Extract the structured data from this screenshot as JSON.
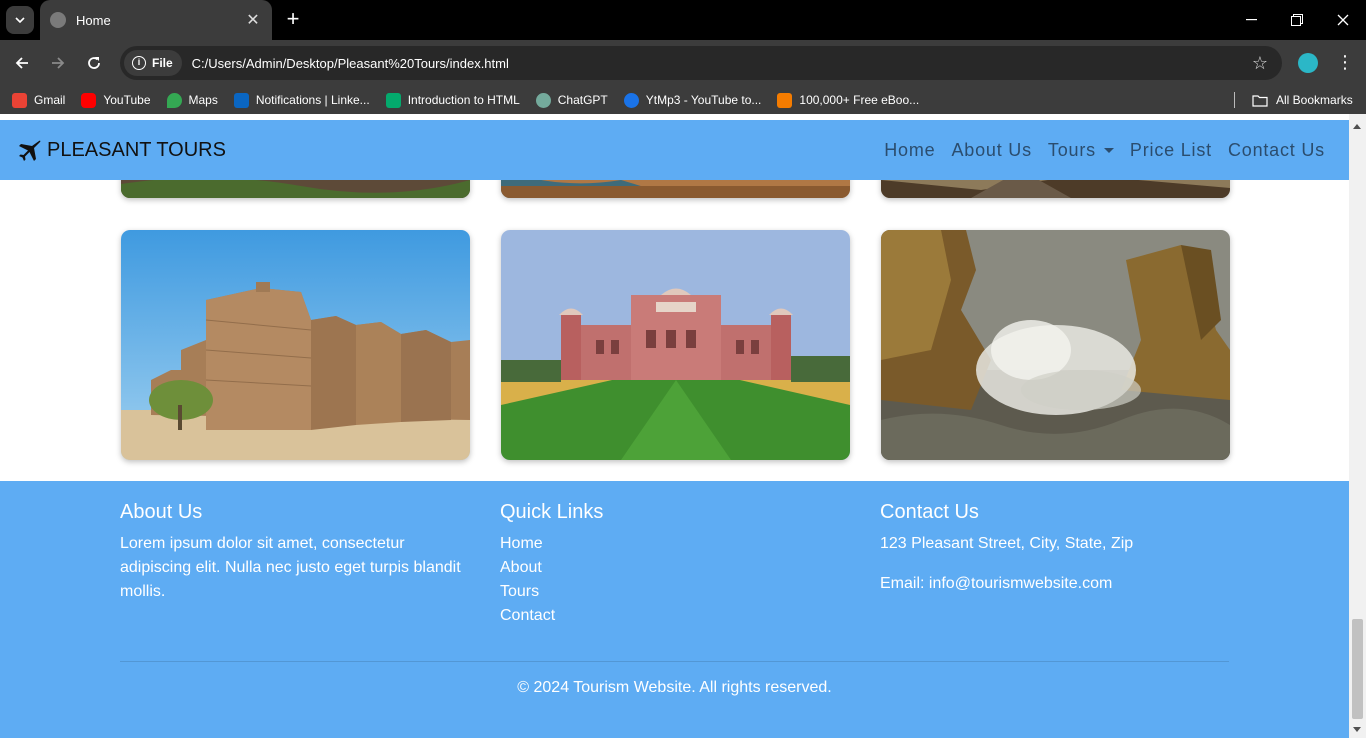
{
  "browser": {
    "tab_title": "Home",
    "url_chip": "File",
    "url": "C:/Users/Admin/Desktop/Pleasant%20Tours/index.html",
    "bookmarks": [
      {
        "label": "Gmail",
        "icon": "gmail-icon",
        "color": "#ea4335"
      },
      {
        "label": "YouTube",
        "icon": "youtube-icon",
        "color": "#ff0000"
      },
      {
        "label": "Maps",
        "icon": "maps-icon",
        "color": "#34a853"
      },
      {
        "label": "Notifications | Linke...",
        "icon": "linkedin-icon",
        "color": "#0a66c2"
      },
      {
        "label": "Introduction to HTML",
        "icon": "w3schools-icon",
        "color": "#04aa6d"
      },
      {
        "label": "ChatGPT",
        "icon": "chatgpt-icon",
        "color": "#74aa9c"
      },
      {
        "label": "YtMp3 - YouTube to...",
        "icon": "ytmp3-icon",
        "color": "#1a73e8"
      },
      {
        "label": "100,000+ Free eBoo...",
        "icon": "ebook-icon",
        "color": "#f57c00"
      }
    ],
    "all_bookmarks": "All Bookmarks"
  },
  "site": {
    "brand": "PLEASANT TOURS",
    "nav": [
      "Home",
      "About Us",
      "Tours",
      "Price List",
      "Contact Us"
    ],
    "accent_color": "#5eacf3"
  },
  "gallery": {
    "cards": [
      {
        "subject": "fort-walls-blue-sky"
      },
      {
        "subject": "red-palace-with-lawn"
      },
      {
        "subject": "sea-waves-crashing-on-rocks"
      }
    ]
  },
  "footer": {
    "about": {
      "heading": "About Us",
      "text": "Lorem ipsum dolor sit amet, consectetur adipiscing elit. Nulla nec justo eget turpis blandit mollis."
    },
    "quick_links": {
      "heading": "Quick Links",
      "links": [
        "Home",
        "About",
        "Tours",
        "Contact"
      ]
    },
    "contact": {
      "heading": "Contact Us",
      "address": "123 Pleasant Street, City, State, Zip",
      "email": "Email: info@tourismwebsite.com"
    },
    "copyright": "© 2024 Tourism Website. All rights reserved."
  }
}
